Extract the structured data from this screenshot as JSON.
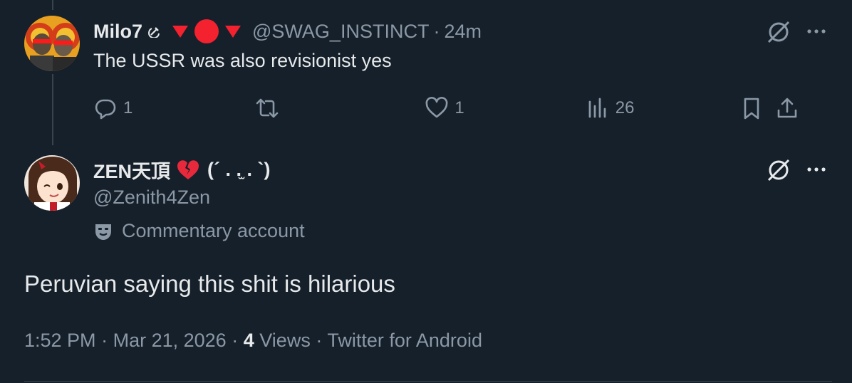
{
  "reply": {
    "display_name": "Milo7",
    "handle": "@SWAG_INSTINCT",
    "separator": "·",
    "time": "24m",
    "text": "The USSR was also revisionist yes",
    "name_emoji": [
      "hammer-sickle-icon",
      "red-triangle-down-icon",
      "red-circle-icon",
      "red-triangle-down-icon"
    ],
    "actions": {
      "reply_count": "1",
      "retweet_count": "",
      "like_count": "1",
      "views_count": "26"
    }
  },
  "main": {
    "display_name": "ZEN天頂",
    "name_suffix": "(´ . .̫ . `)",
    "name_emoji": "broken-heart-icon",
    "handle": "@Zenith4Zen",
    "label": "Commentary account",
    "text": "Peruvian saying this shit is hilarious",
    "meta": {
      "time": "1:52 PM",
      "separator": "·",
      "date": "Mar 21, 2026",
      "views_count": "4",
      "views_label": "Views",
      "client": "Twitter for Android"
    }
  },
  "colors": {
    "background": "#15202b",
    "text": "#e7e9ea",
    "secondary": "#8b98a5",
    "accent_red": "#f4212e"
  }
}
